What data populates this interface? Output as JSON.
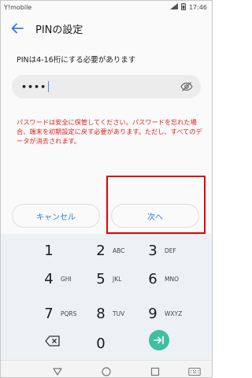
{
  "status_bar": {
    "carrier": "Y!mobile",
    "time": "17:46"
  },
  "app_bar": {
    "title": "PINの設定"
  },
  "pin": {
    "hint": "PINは4-16桁にする必要があります",
    "value": "••••"
  },
  "warning": "パスワードは安全に保管してください。パスワードを忘れた場合、端末を初期設定に戻す必要があります。ただし、すべてのデータが消去されます。",
  "buttons": {
    "cancel": "キャンセル",
    "next": "次へ"
  },
  "keypad": {
    "keys": [
      {
        "num": "1",
        "letters": ""
      },
      {
        "num": "2",
        "letters": "ABC"
      },
      {
        "num": "3",
        "letters": "DEF"
      },
      {
        "num": "4",
        "letters": "GHI"
      },
      {
        "num": "5",
        "letters": "JKL"
      },
      {
        "num": "6",
        "letters": "MNO"
      },
      {
        "num": "7",
        "letters": "PQRS"
      },
      {
        "num": "8",
        "letters": "TUV"
      },
      {
        "num": "9",
        "letters": "WXYZ"
      },
      {
        "num": "0",
        "letters": ""
      }
    ]
  },
  "colors": {
    "accent": "#2b7fe0",
    "warning": "#e02020",
    "go": "#3dbfa0",
    "highlight": "#e00000"
  }
}
